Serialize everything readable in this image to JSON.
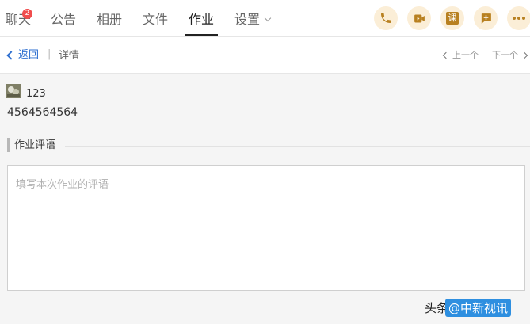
{
  "tabs": [
    {
      "label": "聊天",
      "badge": "2"
    },
    {
      "label": "公告"
    },
    {
      "label": "相册"
    },
    {
      "label": "文件"
    },
    {
      "label": "作业",
      "active": true
    },
    {
      "label": "设置"
    }
  ],
  "toolbar": {
    "icons": [
      "phone-icon",
      "video-icon",
      "lesson-icon",
      "add-message-icon",
      "more-icon"
    ],
    "lesson_glyph": "课",
    "accent": "#b88020",
    "button_bg": "#fbeed7"
  },
  "subbar": {
    "back": "返回",
    "separator": "|",
    "crumb": "详情",
    "prev": "上一个",
    "next": "下一个",
    "link_color": "#2e6fd0"
  },
  "submission": {
    "user": "123",
    "content": "4564564564"
  },
  "review": {
    "title": "作业评语",
    "placeholder": "填写本次作业的评语"
  },
  "watermark": {
    "prefix": "头条",
    "tag": "@中新视讯"
  }
}
